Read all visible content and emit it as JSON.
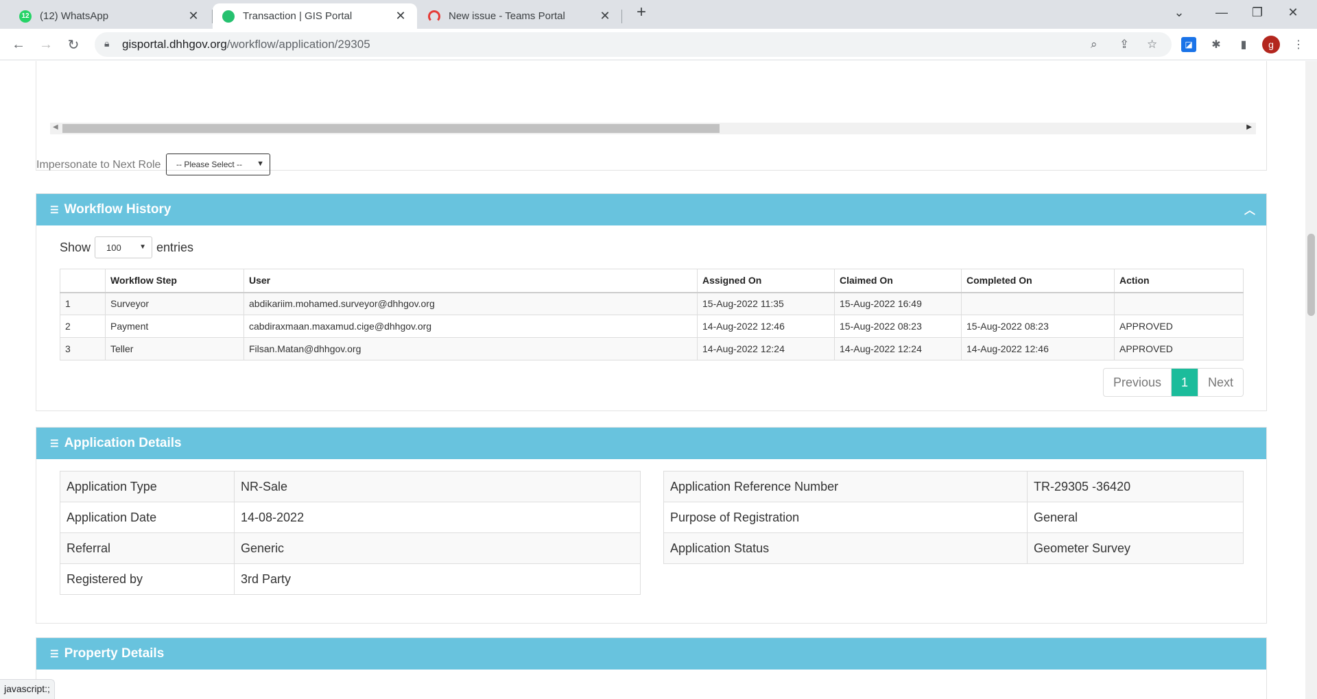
{
  "browser": {
    "tabs": [
      {
        "title": "(12) WhatsApp",
        "favicon_badge": "12",
        "color": "#25d366"
      },
      {
        "title": "Transaction | GIS Portal",
        "active": true,
        "color": "#25c16f"
      },
      {
        "title": "New issue - Teams Portal",
        "color": "#e53935"
      }
    ],
    "url_host": "gisportal.dhhgov.org",
    "url_path": "/workflow/application/29305",
    "avatar_letter": "g",
    "status_text": "javascript:;"
  },
  "top_section": {
    "impersonate_label": "Impersonate to Next Role",
    "impersonate_value": "-- Please Select --"
  },
  "workflow": {
    "title": "Workflow History",
    "show_label": "Show",
    "entries_label": "entries",
    "page_size": "100",
    "columns": [
      "",
      "Workflow Step",
      "User",
      "Assigned On",
      "Claimed On",
      "Completed On",
      "Action"
    ],
    "rows": [
      [
        "1",
        "Surveyor",
        "abdikariim.mohamed.surveyor@dhhgov.org",
        "15-Aug-2022 11:35",
        "15-Aug-2022 16:49",
        "",
        ""
      ],
      [
        "2",
        "Payment",
        "cabdiraxmaan.maxamud.cige@dhhgov.org",
        "14-Aug-2022 12:46",
        "15-Aug-2022 08:23",
        "15-Aug-2022 08:23",
        "APPROVED"
      ],
      [
        "3",
        "Teller",
        "Filsan.Matan@dhhgov.org",
        "14-Aug-2022 12:24",
        "14-Aug-2022 12:24",
        "14-Aug-2022 12:46",
        "APPROVED"
      ]
    ],
    "pager": {
      "previous": "Previous",
      "current": "1",
      "next": "Next"
    }
  },
  "application": {
    "title": "Application Details",
    "left": [
      [
        "Application Type",
        "NR-Sale"
      ],
      [
        "Application Date",
        "14-08-2022"
      ],
      [
        "Referral",
        "Generic"
      ],
      [
        "Registered by",
        "3rd Party"
      ]
    ],
    "right": [
      [
        "Application Reference Number",
        "TR-29305 -36420"
      ],
      [
        "Purpose of Registration",
        "General"
      ],
      [
        "Application Status",
        "Geometer Survey"
      ]
    ]
  },
  "property": {
    "title": "Property Details"
  },
  "colors": {
    "header": "#68c3de",
    "approved": "#26b888",
    "pager_active": "#1bbc9b"
  }
}
